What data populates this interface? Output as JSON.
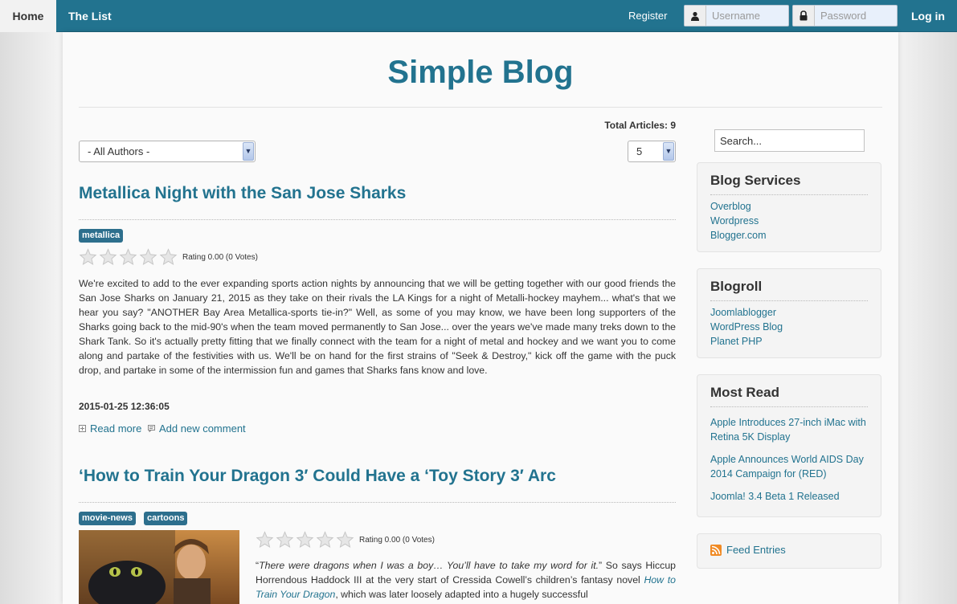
{
  "nav": {
    "home": "Home",
    "the_list": "The List",
    "register": "Register",
    "username_placeholder": "Username",
    "password_placeholder": "Password",
    "login": "Log in"
  },
  "site": {
    "title": "Simple Blog"
  },
  "filters": {
    "total_articles": "Total Articles: 9",
    "author_select": "- All Authors -",
    "per_page_select": "5"
  },
  "articles": [
    {
      "title": "Metallica Night with the San Jose Sharks",
      "tags": [
        "metallica"
      ],
      "rating": "Rating 0.00 (0 Votes)",
      "stars": 0,
      "body": "We're excited to add to the ever expanding sports action nights by announcing that we will be getting together with our good friends the San Jose Sharks on January 21, 2015 as they take on their rivals the LA Kings for a night of Metalli-hockey mayhem... what's that we hear you say? \"ANOTHER Bay Area Metallica-sports tie-in?\" Well, as some of you may know, we have been long supporters of the Sharks going back to the mid-90's when the team moved permanently to San Jose... over the years we've made many treks down to the Shark Tank. So it's actually pretty fitting that we finally connect with the team for a night of metal and hockey and we want you to come along and partake of the festivities with us. We'll be on hand for the first strains of \"Seek & Destroy,\" kick off the game with the puck drop, and partake in some of the intermission fun and games that Sharks fans know and love.",
      "date": "2015-01-25 12:36:05",
      "read_more": "Read more",
      "add_comment": "Add new comment"
    },
    {
      "title": "‘How to Train Your Dragon 3′ Could Have a ‘Toy Story 3′ Arc",
      "tags": [
        "movie-news",
        "cartoons"
      ],
      "rating": "Rating 0.00 (0 Votes)",
      "stars": 0,
      "body_quote": "There were dragons when I was a boy… You’ll have to take my word for it.",
      "body_open": "“",
      "body_after_quote": "” So says Hiccup Horrendous Haddock III at the very start of Cressida Cowell’s children’s fantasy novel ",
      "body_link": "How to Train Your Dragon",
      "body_end": ", which was later loosely adapted into a hugely successful"
    }
  ],
  "sidebar": {
    "search_placeholder": "Search...",
    "blog_services": {
      "title": "Blog Services",
      "links": [
        "Overblog",
        "Wordpress",
        "Blogger.com"
      ]
    },
    "blogroll": {
      "title": "Blogroll",
      "links": [
        "Joomlablogger",
        "WordPress Blog",
        "Planet PHP"
      ]
    },
    "most_read": {
      "title": "Most Read",
      "links": [
        "Apple Introduces 27-inch iMac with Retina 5K Display",
        "Apple Announces World AIDS Day 2014 Campaign for (RED)",
        "Joomla! 3.4 Beta 1 Released"
      ]
    },
    "feed": {
      "label": "Feed Entries"
    }
  },
  "colors": {
    "accent": "#22738f",
    "tag": "#2d6f8d",
    "nav_bg": "#22738f"
  }
}
